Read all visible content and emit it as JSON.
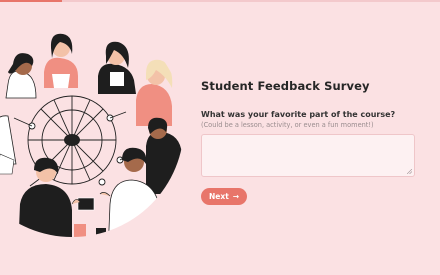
{
  "progress": {
    "value_percent": 14,
    "accent": "#e8756a"
  },
  "survey": {
    "title": "Student Feedback Survey",
    "question": "What was your favorite part of the course?",
    "hint": "(Could be a lesson, activity, or even a fun moment!)",
    "answer_value": "",
    "next_label": "Next",
    "next_icon": "arrow-right-icon",
    "next_glyph": "→"
  },
  "illustration": {
    "subject": "group-of-students-discussion-illustration"
  },
  "colors": {
    "background": "#fbe1e3",
    "accent": "#e8756a",
    "field": "#fdf1f2"
  }
}
